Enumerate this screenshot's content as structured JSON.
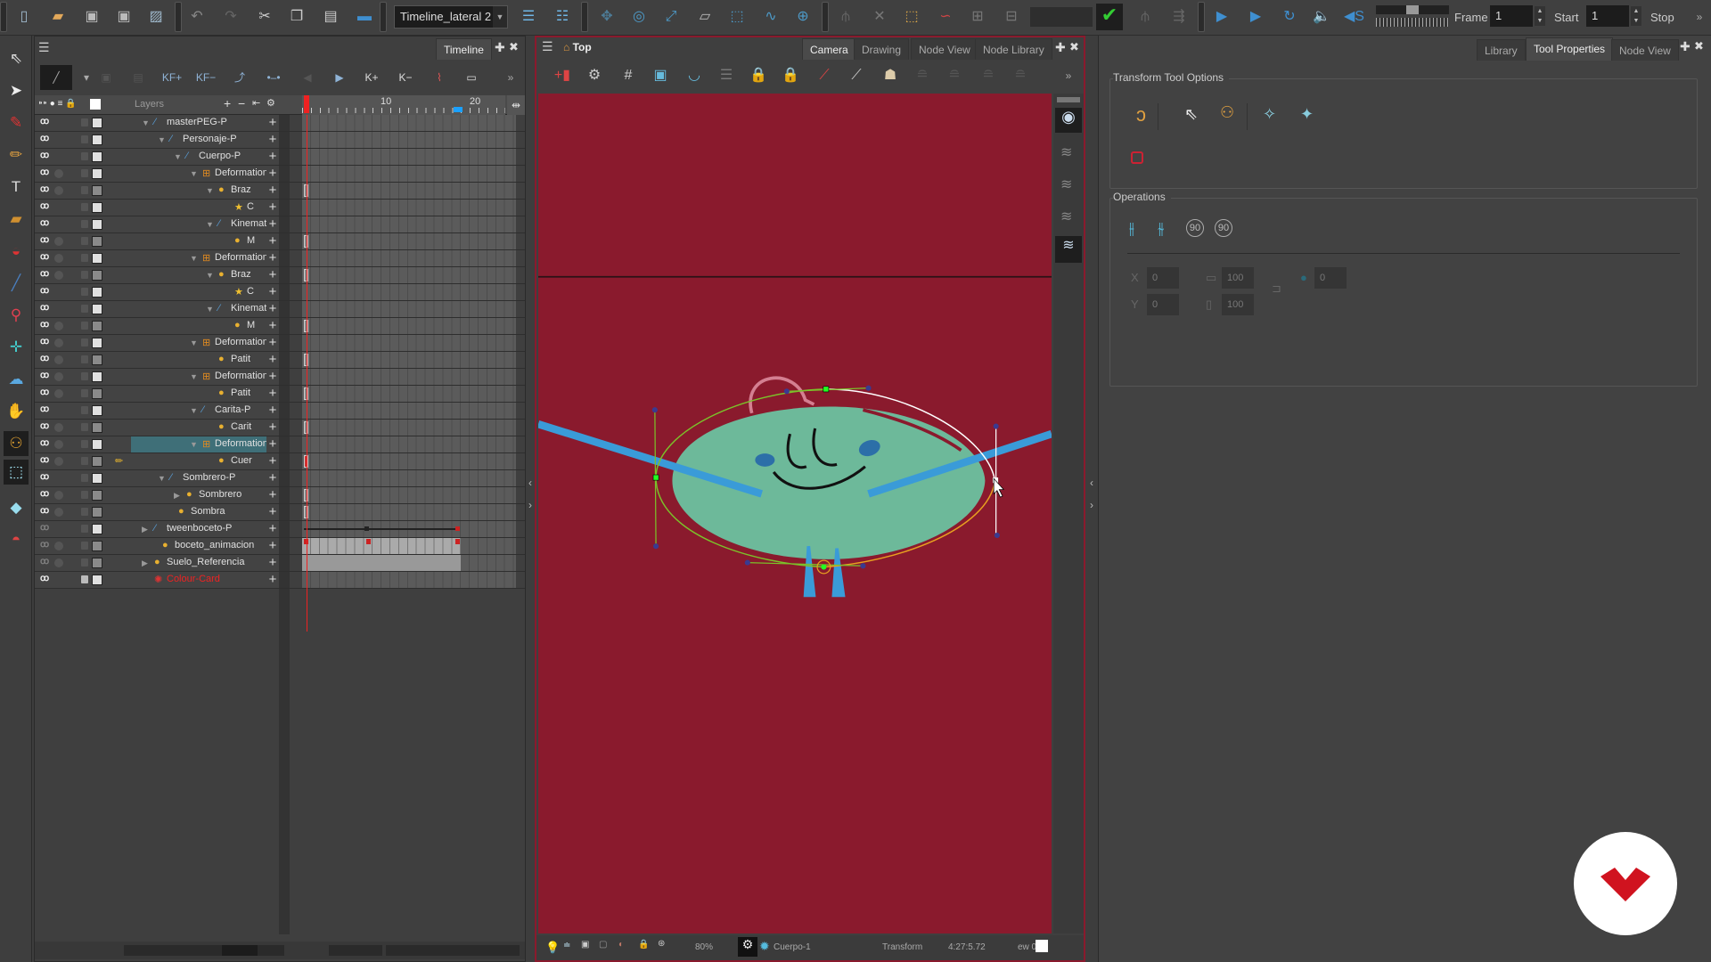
{
  "toolbar": {
    "timeline_selector": "Timeline_lateral 2",
    "frame_label": "Frame",
    "frame_value": "1",
    "start_label": "Start",
    "start_value": "1",
    "stop_label": "Stop"
  },
  "timeline": {
    "tab": "Timeline",
    "layers_header": "Layers",
    "ruler_labels": [
      "10",
      "20"
    ],
    "current_frame": 1,
    "layers": [
      {
        "name": "masterPEG-P",
        "level": 0,
        "type": "peg",
        "expand": "open"
      },
      {
        "name": "Personaje-P",
        "level": 1,
        "type": "peg",
        "expand": "open"
      },
      {
        "name": "Cuerpo-P",
        "level": 2,
        "type": "peg",
        "expand": "open"
      },
      {
        "name": "Deformation-",
        "level": 3,
        "type": "deform",
        "expand": "open"
      },
      {
        "name": "Braz",
        "level": 4,
        "type": "drawing",
        "expand": "open",
        "key": true
      },
      {
        "name": "C",
        "level": 5,
        "type": "star"
      },
      {
        "name": "Kinemati",
        "level": 4,
        "type": "peg",
        "expand": "open"
      },
      {
        "name": "M",
        "level": 5,
        "type": "drawing",
        "key": true
      },
      {
        "name": "Deformation-",
        "level": 3,
        "type": "deform",
        "expand": "open"
      },
      {
        "name": "Braz",
        "level": 4,
        "type": "drawing",
        "expand": "open",
        "key": true
      },
      {
        "name": "C",
        "level": 5,
        "type": "star"
      },
      {
        "name": "Kinemati",
        "level": 4,
        "type": "peg",
        "expand": "open"
      },
      {
        "name": "M",
        "level": 5,
        "type": "drawing",
        "key": true
      },
      {
        "name": "Deformation-",
        "level": 3,
        "type": "deform",
        "expand": "open"
      },
      {
        "name": "Patit",
        "level": 4,
        "type": "drawing",
        "key": true
      },
      {
        "name": "Deformation-",
        "level": 3,
        "type": "deform",
        "expand": "open"
      },
      {
        "name": "Patit",
        "level": 4,
        "type": "drawing",
        "key": true
      },
      {
        "name": "Carita-P",
        "level": 3,
        "type": "peg",
        "expand": "open"
      },
      {
        "name": "Carit",
        "level": 4,
        "type": "drawing",
        "key": true
      },
      {
        "name": "Deformation-",
        "level": 3,
        "type": "deform",
        "expand": "open",
        "selected": true
      },
      {
        "name": "Cuer",
        "level": 4,
        "type": "drawing",
        "key": true,
        "editing": true
      },
      {
        "name": "Sombrero-P",
        "level": 1,
        "type": "peg",
        "expand": "open"
      },
      {
        "name": "Sombrero",
        "level": 2,
        "type": "drawing",
        "expand": "closed",
        "key": true
      },
      {
        "name": "Sombra",
        "level": 1.5,
        "type": "drawing",
        "key": true
      },
      {
        "name": "tweenboceto-P",
        "level": 0,
        "type": "peg",
        "expand": "closed",
        "disabled": true
      },
      {
        "name": "boceto_animacion",
        "level": 0.5,
        "type": "drawing",
        "disabled": true
      },
      {
        "name": "Suelo_Referencia",
        "level": 0,
        "type": "drawing",
        "expand": "closed",
        "disabled": true
      },
      {
        "name": "Colour-Card",
        "level": 0,
        "type": "colourcard",
        "locked": true
      }
    ]
  },
  "viewer": {
    "title": "Top",
    "tabs": [
      "Camera",
      "Drawing",
      "Node View",
      "Node Library"
    ],
    "active_tab": "Camera",
    "background_color": "#8a1a2d",
    "status": {
      "zoom": "80%",
      "layer": "Cuerpo-1",
      "tool": "Transform",
      "coords": "4:27:5.72",
      "view": "ew 0"
    }
  },
  "right_panel": {
    "tabs": [
      "Library",
      "Tool Properties",
      "Node View"
    ],
    "active_tab": "Tool Properties",
    "tool_options_title": "Transform Tool Options",
    "operations_title": "Operations",
    "fields": {
      "x": "0",
      "y": "0",
      "width": "100",
      "height": "100",
      "angle": "0"
    }
  },
  "colors": {
    "accent_selected": "#3f6f78",
    "viewer_border": "#8a1a2d",
    "character_body": "#6db99a",
    "arms": "#3a9bd8"
  }
}
